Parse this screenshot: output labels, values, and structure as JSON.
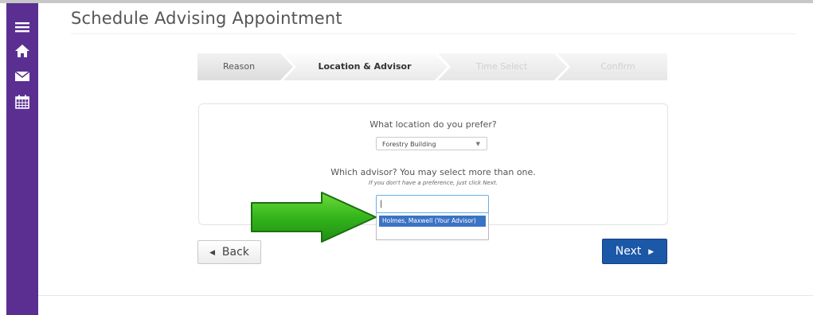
{
  "page": {
    "title": "Schedule Advising Appointment"
  },
  "sidebar": {
    "items": [
      {
        "icon": "menu-icon"
      },
      {
        "icon": "home-icon"
      },
      {
        "icon": "mail-icon"
      },
      {
        "icon": "calendar-icon"
      }
    ]
  },
  "steps": [
    {
      "label": "Reason",
      "state": "done"
    },
    {
      "label": "Location & Advisor",
      "state": "active"
    },
    {
      "label": "Time Select",
      "state": "pending"
    },
    {
      "label": "Confirm",
      "state": "pending"
    }
  ],
  "form": {
    "location_question": "What location do you prefer?",
    "location_value": "Forestry Building",
    "advisor_question": "Which advisor? You may select more than one.",
    "advisor_hint": "If you don't have a preference, just click Next.",
    "advisor_input_value": "|",
    "advisor_options": [
      "Holmes, Maxwell (Your Advisor)"
    ]
  },
  "nav": {
    "back_label": "Back",
    "next_label": "Next"
  },
  "colors": {
    "sidebar": "#5b2f92",
    "primary_button": "#1c58a8",
    "highlight": "#3b73c4",
    "arrow": "#2fae1b"
  }
}
